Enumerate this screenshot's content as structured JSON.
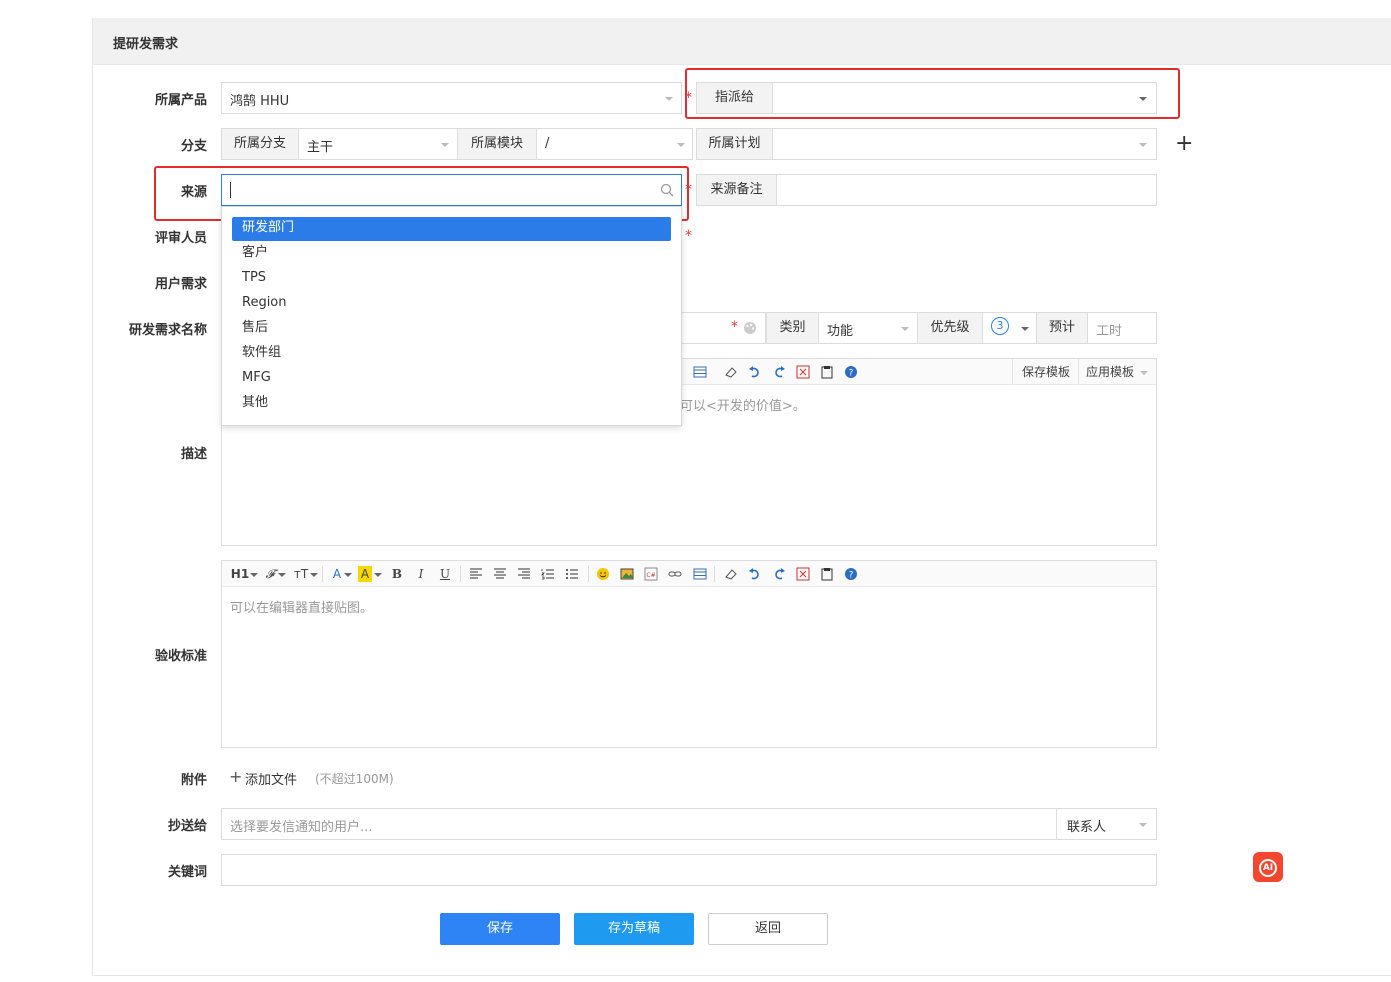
{
  "page": {
    "title": "提研发需求"
  },
  "labels": {
    "product": "所属产品",
    "branch": "分支",
    "source": "来源",
    "reviewer": "评审人员",
    "user_req": "用户需求",
    "req_name": "研发需求名称",
    "desc": "描述",
    "verify": "验收标准",
    "attach": "附件",
    "cc": "抄送给",
    "keywords": "关键词"
  },
  "product": {
    "value": "鸿鹄 HHU"
  },
  "assign": {
    "label": "指派给",
    "value": ""
  },
  "branch": {
    "addon": "所属分支",
    "value": "主干"
  },
  "module": {
    "addon": "所属模块",
    "value": "/"
  },
  "plan": {
    "addon": "所属计划",
    "value": ""
  },
  "source": {
    "value": "",
    "note_label": "来源备注"
  },
  "source_options": [
    "研发部门",
    "客户",
    "TPS",
    "Region",
    "售后",
    "软件组",
    "MFG",
    "其他"
  ],
  "meta": {
    "category_label": "类别",
    "category_value": "功能",
    "priority_label": "优先级",
    "priority_value": "3",
    "estimate_label": "预计",
    "estimate_placeholder": "工时"
  },
  "desc_editor": {
    "save_template": "保存模板",
    "apply_template": "应用模板",
    "placeholder_tail": "可以<开发的价值>。"
  },
  "verify_editor": {
    "placeholder": "可以在编辑器直接贴图。",
    "toolbar": [
      "H1",
      "𝓕",
      "тT",
      "A",
      "A",
      "B",
      "I",
      "U"
    ]
  },
  "attach": {
    "add_label": "添加文件",
    "limit": "(不超过100M)"
  },
  "cc": {
    "placeholder": "选择要发信通知的用户...",
    "contact_label": "联系人"
  },
  "buttons": {
    "save": "保存",
    "draft": "存为草稿",
    "back": "返回"
  },
  "ai_badge": "AI"
}
